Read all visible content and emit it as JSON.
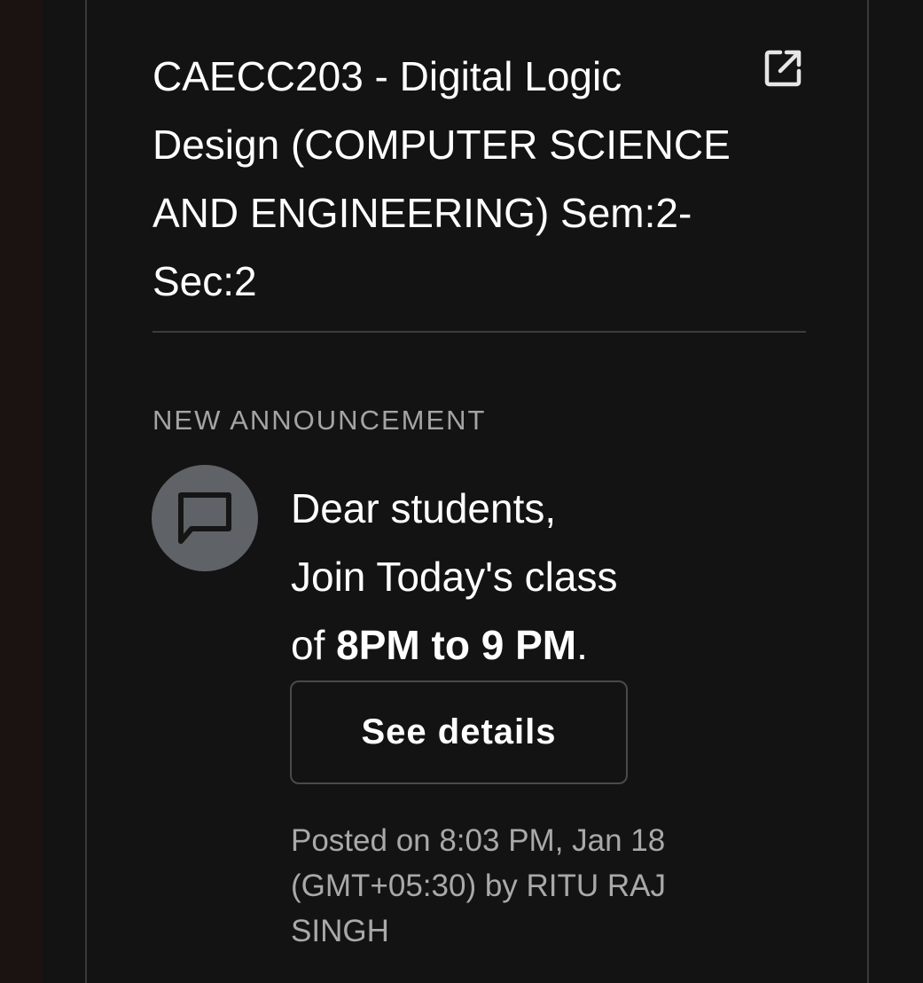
{
  "card": {
    "course_title": "CAECC203 - Digital Logic Design (COMPUTER SCIENCE AND ENGINEERING) Sem:2-Sec:2",
    "open_icon": "open-in-new-icon"
  },
  "announcement": {
    "section_label": "NEW ANNOUNCEMENT",
    "avatar_icon": "chat-bubble-icon",
    "line1": "Dear students,",
    "line2": "Join Today's class",
    "line3_prefix": "of ",
    "line3_bold": "8PM to 9 PM",
    "line3_suffix": ".",
    "button_label": "See details",
    "posted_text": "Posted on 8:03 PM, Jan 18 (GMT+05:30) by RITU RAJ SINGH"
  },
  "colors": {
    "background": "#131313",
    "avatar": "#5f6266",
    "muted_text": "#a9a9a9",
    "divider": "#3c3c3c"
  }
}
